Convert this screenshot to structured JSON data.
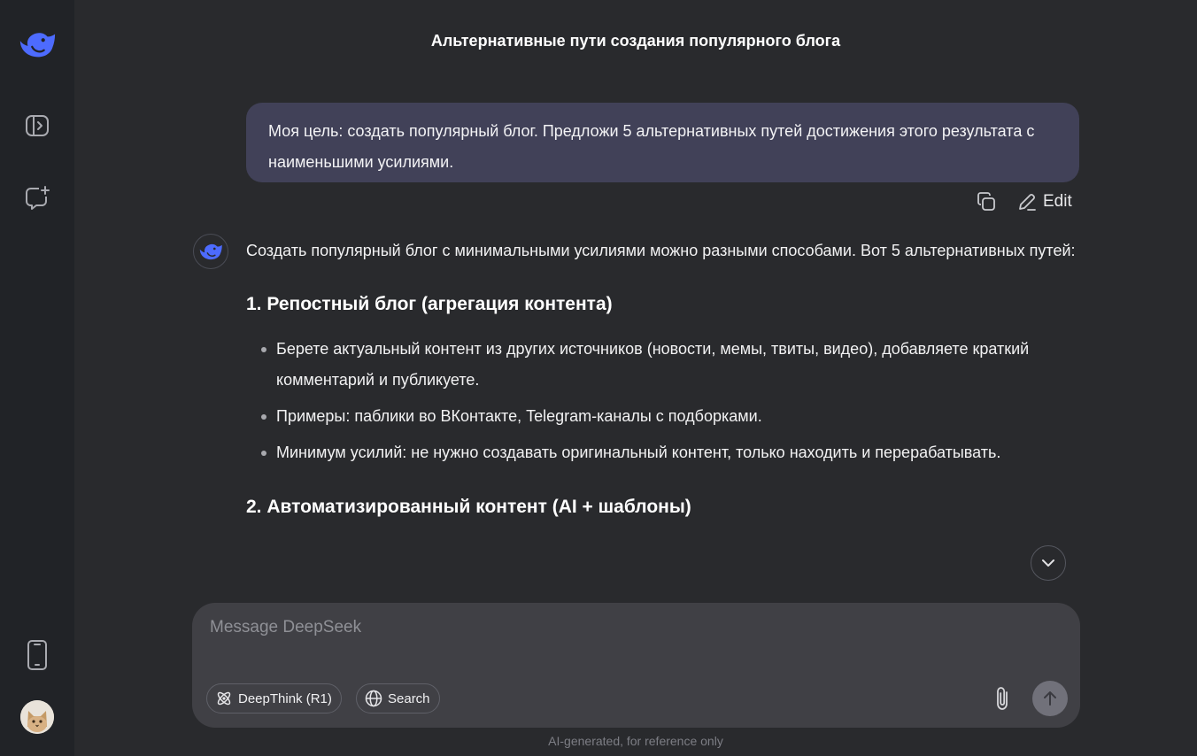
{
  "sidebar": {
    "logo_icon": "deepseek-whale-logo",
    "toggle_icon": "sidebar-toggle-icon",
    "new_chat_icon": "new-chat-icon",
    "app_icon": "mobile-phone-icon",
    "avatar_icon": "cat-avatar"
  },
  "header": {
    "title": "Альтернативные пути создания популярного блога"
  },
  "user_message": {
    "text": "Моя цель: создать популярный блог. Предложи 5 альтернативных путей достижения этого результата с наименьшими усилиями.",
    "copy_icon": "copy-icon",
    "edit_label": "Edit"
  },
  "answer": {
    "intro": "Создать популярный блог с минимальными усилиями можно разными способами. Вот 5 альтернативных путей:",
    "sections": [
      {
        "heading_num": "1.",
        "heading": "Репостный блог (агрегация контента)",
        "bullets": [
          "Берете актуальный контент из других источников (новости, мемы, твиты, видео), добавляете краткий комментарий и публикуете.",
          "Примеры: паблики во ВКонтакте, Telegram-каналы с подборками.",
          "Минимум усилий: не нужно создавать оригинальный контент, только находить и перерабатывать."
        ]
      },
      {
        "heading_num": "2.",
        "heading": "Автоматизированный контент (AI + шаблоны)"
      }
    ]
  },
  "composer": {
    "placeholder": "Message DeepSeek",
    "deepthink_label": "DeepThink (R1)",
    "search_label": "Search"
  },
  "footer": {
    "note": "AI-generated, for reference only"
  },
  "colors": {
    "accent": "#4d6bfe",
    "background": "#292a2d",
    "sidebar": "#212327",
    "user_bubble": "#414158"
  }
}
